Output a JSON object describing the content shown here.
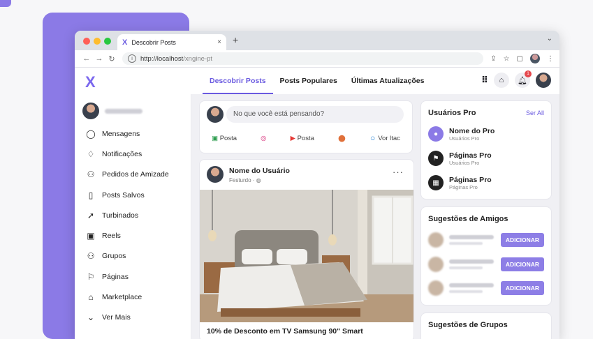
{
  "browser": {
    "tab_title": "Descobrir Posts",
    "tab_close": "×",
    "new_tab": "+",
    "url_base": "http://localhost",
    "url_path": "/xngine-pt"
  },
  "app": {
    "logo": "X",
    "nav": [
      {
        "label": "Descobrir Posts"
      },
      {
        "label": "Posts Populares"
      },
      {
        "label": "Últimas Atualizações"
      }
    ],
    "notification_count": "1"
  },
  "sidebar": {
    "items": [
      {
        "label": "Mensagens",
        "icon": "chat-icon"
      },
      {
        "label": "Notificações",
        "icon": "bell-icon"
      },
      {
        "label": "Pedidos de Amizade",
        "icon": "users-icon"
      },
      {
        "label": "Posts Salvos",
        "icon": "bookmark-icon"
      },
      {
        "label": "Turbinados",
        "icon": "rocket-icon"
      },
      {
        "label": "Reels",
        "icon": "reels-icon"
      },
      {
        "label": "Grupos",
        "icon": "group-icon"
      },
      {
        "label": "Páginas",
        "icon": "flag-icon"
      },
      {
        "label": "Marketplace",
        "icon": "store-icon"
      },
      {
        "label": "Ver Mais",
        "icon": "chevron-down-icon"
      }
    ]
  },
  "composer": {
    "placeholder": "No que você está pensando?",
    "actions": [
      {
        "label": "Posta",
        "icon": "image-icon"
      },
      {
        "label": "",
        "icon": "instagram-icon"
      },
      {
        "label": "Posta",
        "icon": "youtube-icon"
      },
      {
        "label": "",
        "icon": "location-icon"
      },
      {
        "label": "Vor ltac",
        "icon": "emoji-icon"
      }
    ]
  },
  "post": {
    "author": "Nome do Usuário",
    "meta": "Festurdo · ",
    "more": "···",
    "caption": "10% de Desconto em TV Samsung 90\" Smart"
  },
  "pro_users": {
    "title": "Usuários Pro",
    "link": "Ser All",
    "items": [
      {
        "name": "Nome do Pro",
        "sub": "Usuários Pro",
        "color": "#8b7ae6"
      },
      {
        "name": "Páginas Pro",
        "sub": "Usuários Pro",
        "color": "#222222"
      },
      {
        "name": "Páginas Pro",
        "sub": "Páginas Pro",
        "color": "#222222"
      }
    ]
  },
  "friend_suggestions": {
    "title": "Sugestões de Amigos",
    "button": "ADICIONAR"
  },
  "group_suggestions": {
    "title": "Sugestões de Grupos"
  },
  "colors": {
    "accent": "#6a5ae0",
    "purple_card": "#8b7ae6",
    "add_button": "#8d7ee6"
  }
}
